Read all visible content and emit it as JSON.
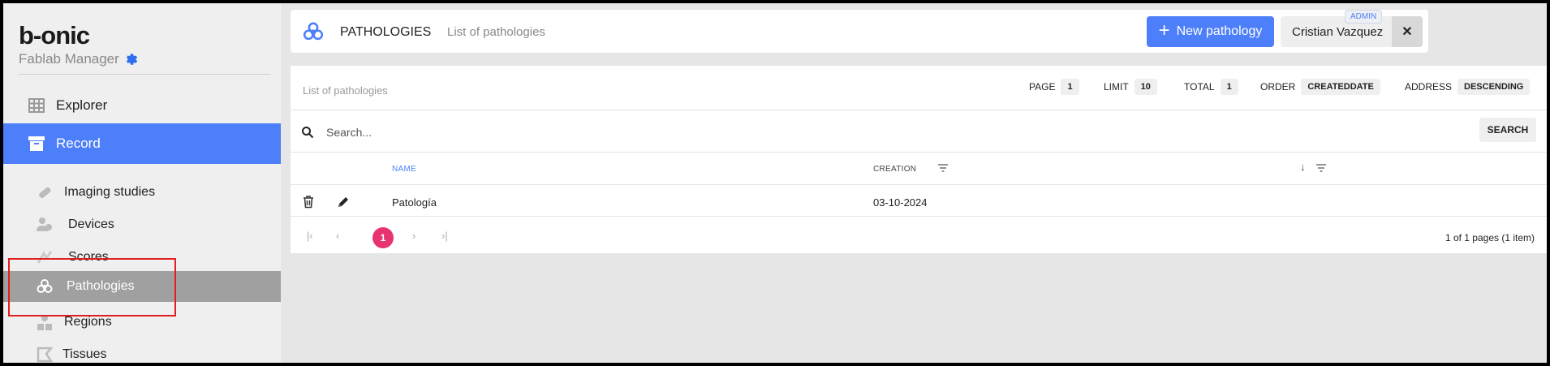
{
  "sidebar": {
    "brand": "b-onic",
    "subbrand": "Fablab Manager",
    "items": [
      {
        "label": "Explorer",
        "icon": "grid-icon"
      },
      {
        "label": "Record",
        "icon": "archive-icon",
        "active": true
      }
    ],
    "subitems": [
      {
        "label": "Imaging studies",
        "icon": "bandage-icon"
      },
      {
        "label": "Devices",
        "icon": "users-icon"
      },
      {
        "label": "Scores",
        "icon": "scores-icon"
      },
      {
        "label": "Pathologies",
        "icon": "biohazard-icon",
        "active": true
      },
      {
        "label": "Regions",
        "icon": "shapes-icon"
      },
      {
        "label": "Tissues",
        "icon": "tissue-icon"
      }
    ]
  },
  "header": {
    "title": "PATHOLOGIES",
    "breadcrumb": "List of pathologies",
    "new_button": "New pathology",
    "user_name": "Cristian Vazquez",
    "role_badge": "ADMIN",
    "close_label": "✕"
  },
  "list": {
    "label": "List of pathologies",
    "page_label": "PAGE",
    "page_value": "1",
    "limit_label": "LIMIT",
    "limit_value": "10",
    "total_label": "TOTAL",
    "total_value": "1",
    "order_label": "ORDER",
    "order_value": "CREATEDDATE",
    "address_label": "ADDRESS",
    "address_value": "DESCENDING",
    "search_placeholder": "Search...",
    "search_button": "SEARCH",
    "columns": {
      "name": "NAME",
      "creation": "CREATION"
    },
    "rows": [
      {
        "name": "Patología",
        "creation": "03-10-2024"
      }
    ],
    "pagination": {
      "current": "1",
      "info": "1 of 1 pages (1 item)"
    }
  },
  "colors": {
    "accent": "#4d7ffa",
    "page_active": "#e8336e",
    "highlight": "#e02020"
  }
}
